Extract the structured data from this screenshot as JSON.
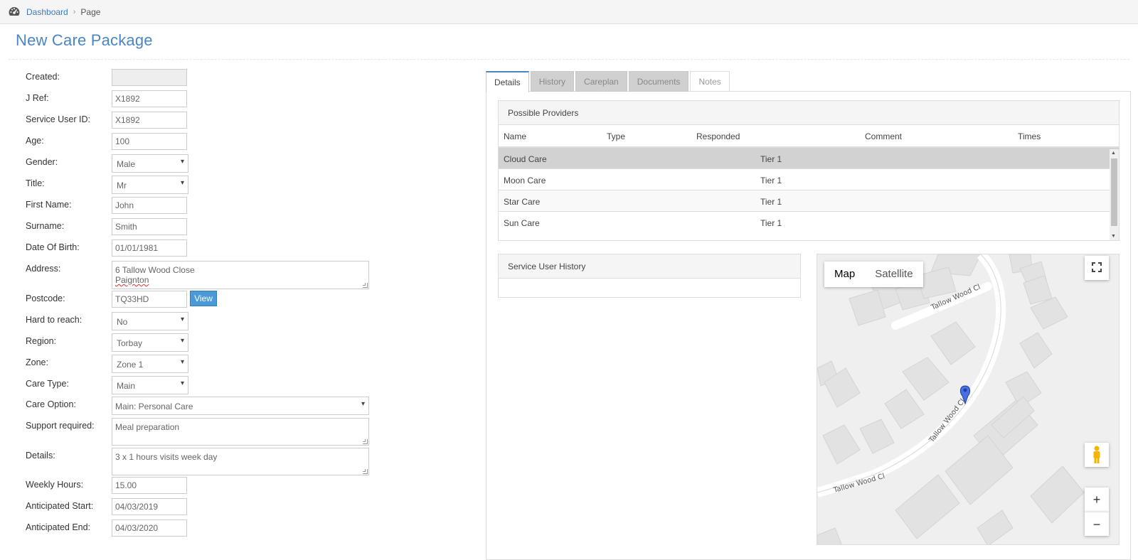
{
  "breadcrumb": {
    "home": "Dashboard",
    "current": "Page"
  },
  "page_title": "New Care Package",
  "form": {
    "created": {
      "label": "Created:",
      "value": ""
    },
    "jref": {
      "label": "J Ref:",
      "value": "X1892"
    },
    "service_user_id": {
      "label": "Service User ID:",
      "value": "X1892"
    },
    "age": {
      "label": "Age:",
      "value": "100"
    },
    "gender": {
      "label": "Gender:",
      "value": "Male"
    },
    "title": {
      "label": "Title:",
      "value": "Mr"
    },
    "first_name": {
      "label": "First Name:",
      "value": "John"
    },
    "surname": {
      "label": "Surname:",
      "value": "Smith"
    },
    "dob": {
      "label": "Date Of Birth:",
      "value": "01/01/1981"
    },
    "address": {
      "label": "Address:",
      "line1": "6 Tallow Wood Close",
      "line2": "Paignton"
    },
    "postcode": {
      "label": "Postcode:",
      "value": "TQ33HD",
      "button": "View"
    },
    "hard_to_reach": {
      "label": "Hard to reach:",
      "value": "No"
    },
    "region": {
      "label": "Region:",
      "value": "Torbay"
    },
    "zone": {
      "label": "Zone:",
      "value": "Zone 1"
    },
    "care_type": {
      "label": "Care Type:",
      "value": "Main"
    },
    "care_option": {
      "label": "Care Option:",
      "value": "Main: Personal Care"
    },
    "support_required": {
      "label": "Support required:",
      "value": "Meal preparation"
    },
    "details": {
      "label": "Details:",
      "value": "3 x 1 hours visits week day"
    },
    "weekly_hours": {
      "label": "Weekly Hours:",
      "value": "15.00"
    },
    "anticipated_start": {
      "label": "Anticipated Start:",
      "value": "04/03/2019"
    },
    "anticipated_end": {
      "label": "Anticipated End:",
      "value": "04/03/2020"
    }
  },
  "tabs": [
    "Details",
    "History",
    "Careplan",
    "Documents",
    "Notes"
  ],
  "providers": {
    "heading": "Possible Providers",
    "columns": [
      "Name",
      "Type",
      "Responded",
      "Comment",
      "Times"
    ],
    "rows": [
      {
        "name": "Cloud Care",
        "comment": "Tier 1"
      },
      {
        "name": "Moon Care",
        "comment": "Tier 1"
      },
      {
        "name": "Star Care",
        "comment": "Tier 1"
      },
      {
        "name": "Sun Care",
        "comment": "Tier 1"
      }
    ]
  },
  "service_user_history": {
    "heading": "Service User History"
  },
  "map": {
    "type_map": "Map",
    "type_satellite": "Satellite",
    "street_labels": [
      "Tallow Wood Cl",
      "Tallow Wood Cl",
      "Tallow Wood Cl"
    ]
  },
  "colors": {
    "accent": "#4a86c5",
    "link": "#3d7ab8",
    "button": "#4a9ad8"
  }
}
